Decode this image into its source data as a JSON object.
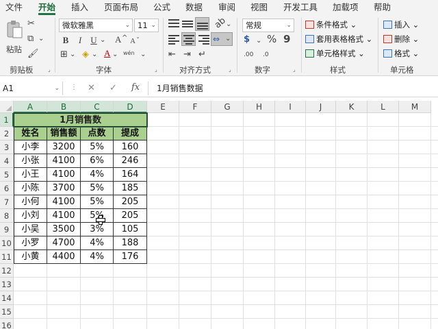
{
  "tabs": [
    "文件",
    "开始",
    "插入",
    "页面布局",
    "公式",
    "数据",
    "审阅",
    "视图",
    "开发工具",
    "加载项",
    "帮助"
  ],
  "active_tab": "开始",
  "ribbon": {
    "clipboard": {
      "paste_label": "粘贴",
      "group_label": "剪贴板"
    },
    "font": {
      "font_name": "微软雅黑",
      "font_size": "11",
      "grow_label": "A",
      "shrink_label": "A",
      "bold_label": "B",
      "italic_label": "I",
      "underline_label": "U",
      "font_color_label": "A",
      "phonetic_label": "wén",
      "group_label": "字体"
    },
    "alignment": {
      "group_label": "对齐方式"
    },
    "number": {
      "format": "常规",
      "currency_label": "$",
      "percent_label": "%",
      "comma_label": "9",
      "inc_decimal_label": ".00",
      "dec_decimal_label": ".0",
      "group_label": "数字"
    },
    "styles": {
      "conditional": "条件格式",
      "table_format": "套用表格格式",
      "cell_style": "单元格样式",
      "group_label": "样式"
    },
    "cells": {
      "insert": "插入",
      "delete": "删除",
      "format": "格式",
      "group_label": "单元格"
    }
  },
  "formula_bar": {
    "name_box": "A1",
    "fx_label": "fx",
    "content": "1月销售数据"
  },
  "columns": [
    "A",
    "B",
    "C",
    "D",
    "E",
    "F",
    "G",
    "H",
    "I",
    "J",
    "K",
    "L",
    "M"
  ],
  "rows": [
    "1",
    "2",
    "3",
    "4",
    "5",
    "6",
    "7",
    "8",
    "9",
    "10",
    "11",
    "12",
    "13",
    "14",
    "15",
    "16"
  ],
  "table": {
    "title": "1月销售数",
    "headers": [
      "姓名",
      "销售额",
      "点数",
      "提成"
    ],
    "rows": [
      [
        "小李",
        "3200",
        "5%",
        "160"
      ],
      [
        "小张",
        "4100",
        "6%",
        "246"
      ],
      [
        "小王",
        "4100",
        "4%",
        "164"
      ],
      [
        "小陈",
        "3700",
        "5%",
        "185"
      ],
      [
        "小何",
        "4100",
        "5%",
        "205"
      ],
      [
        "小刘",
        "4100",
        "5%",
        "205"
      ],
      [
        "小吴",
        "3500",
        "3%",
        "105"
      ],
      [
        "小罗",
        "4700",
        "4%",
        "188"
      ],
      [
        "小黄",
        "4400",
        "4%",
        "176"
      ]
    ]
  },
  "colors": {
    "accent": "#217346",
    "header_fill": "#a9d08e",
    "ribbon_bg": "#f3f3f3"
  }
}
